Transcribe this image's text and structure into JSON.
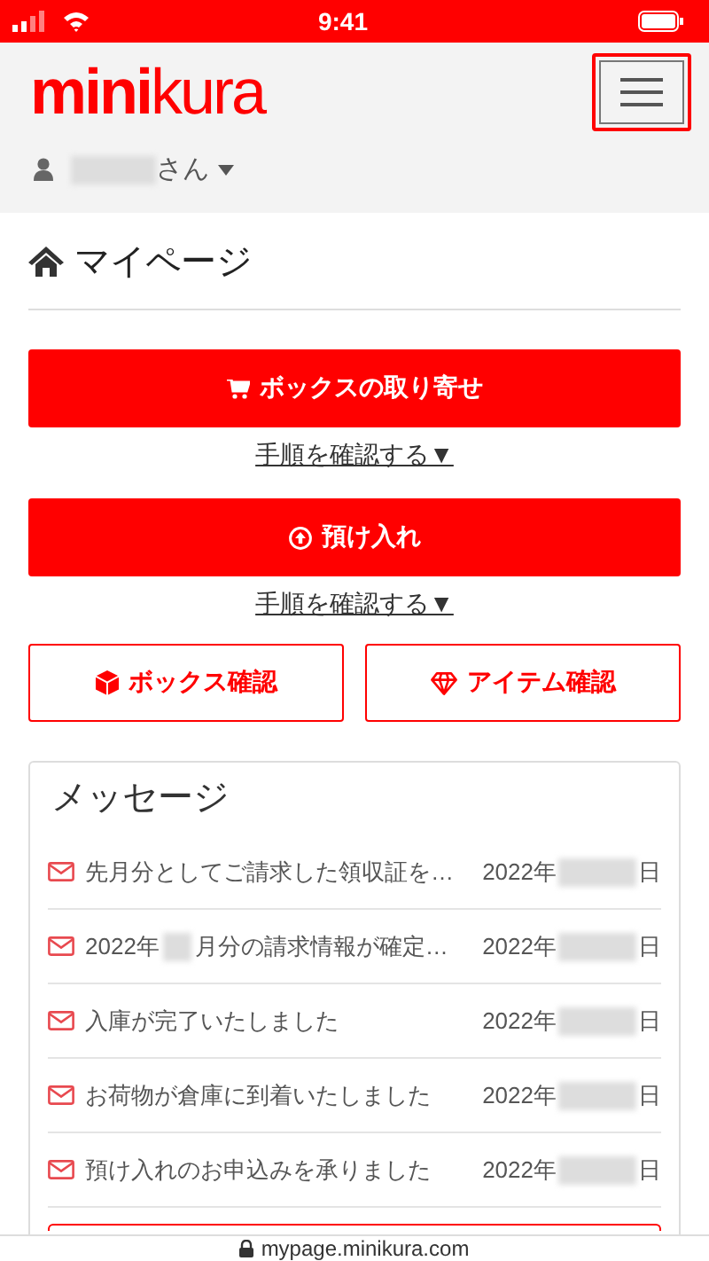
{
  "status_bar": {
    "time": "9:41"
  },
  "header": {
    "logo": "**mini**kura",
    "user_suffix": "さん"
  },
  "page_title": "マイページ",
  "actions": [
    {
      "kind": "filled",
      "label": "ボックスの取り寄せ",
      "help": "手順を確認する▼"
    },
    {
      "kind": "filled",
      "label": "預け入れ",
      "help": "手順を確認する▼"
    }
  ],
  "secondary_buttons": [
    {
      "label": "ボックス確認"
    },
    {
      "label": "アイテム確認"
    }
  ],
  "messages": {
    "title": "メッセージ",
    "items": [
      {
        "title_parts": [
          "先月分としてご請求した領収証を…"
        ],
        "date_prefix": "2022年",
        "date_suffix": "日"
      },
      {
        "title_parts": [
          "2022年",
          "月分の請求情報が確定…"
        ],
        "date_prefix": "2022年",
        "date_suffix": "日"
      },
      {
        "title_parts": [
          "入庫が完了いたしました"
        ],
        "date_prefix": "2022年",
        "date_suffix": "日"
      },
      {
        "title_parts": [
          "お荷物が倉庫に到着いたしました"
        ],
        "date_prefix": "2022年",
        "date_suffix": "日"
      },
      {
        "title_parts": [
          "預け入れのお申込みを承りました"
        ],
        "date_prefix": "2022年",
        "date_suffix": "日"
      }
    ]
  },
  "url_bar": {
    "domain": "mypage.minikura.com"
  }
}
